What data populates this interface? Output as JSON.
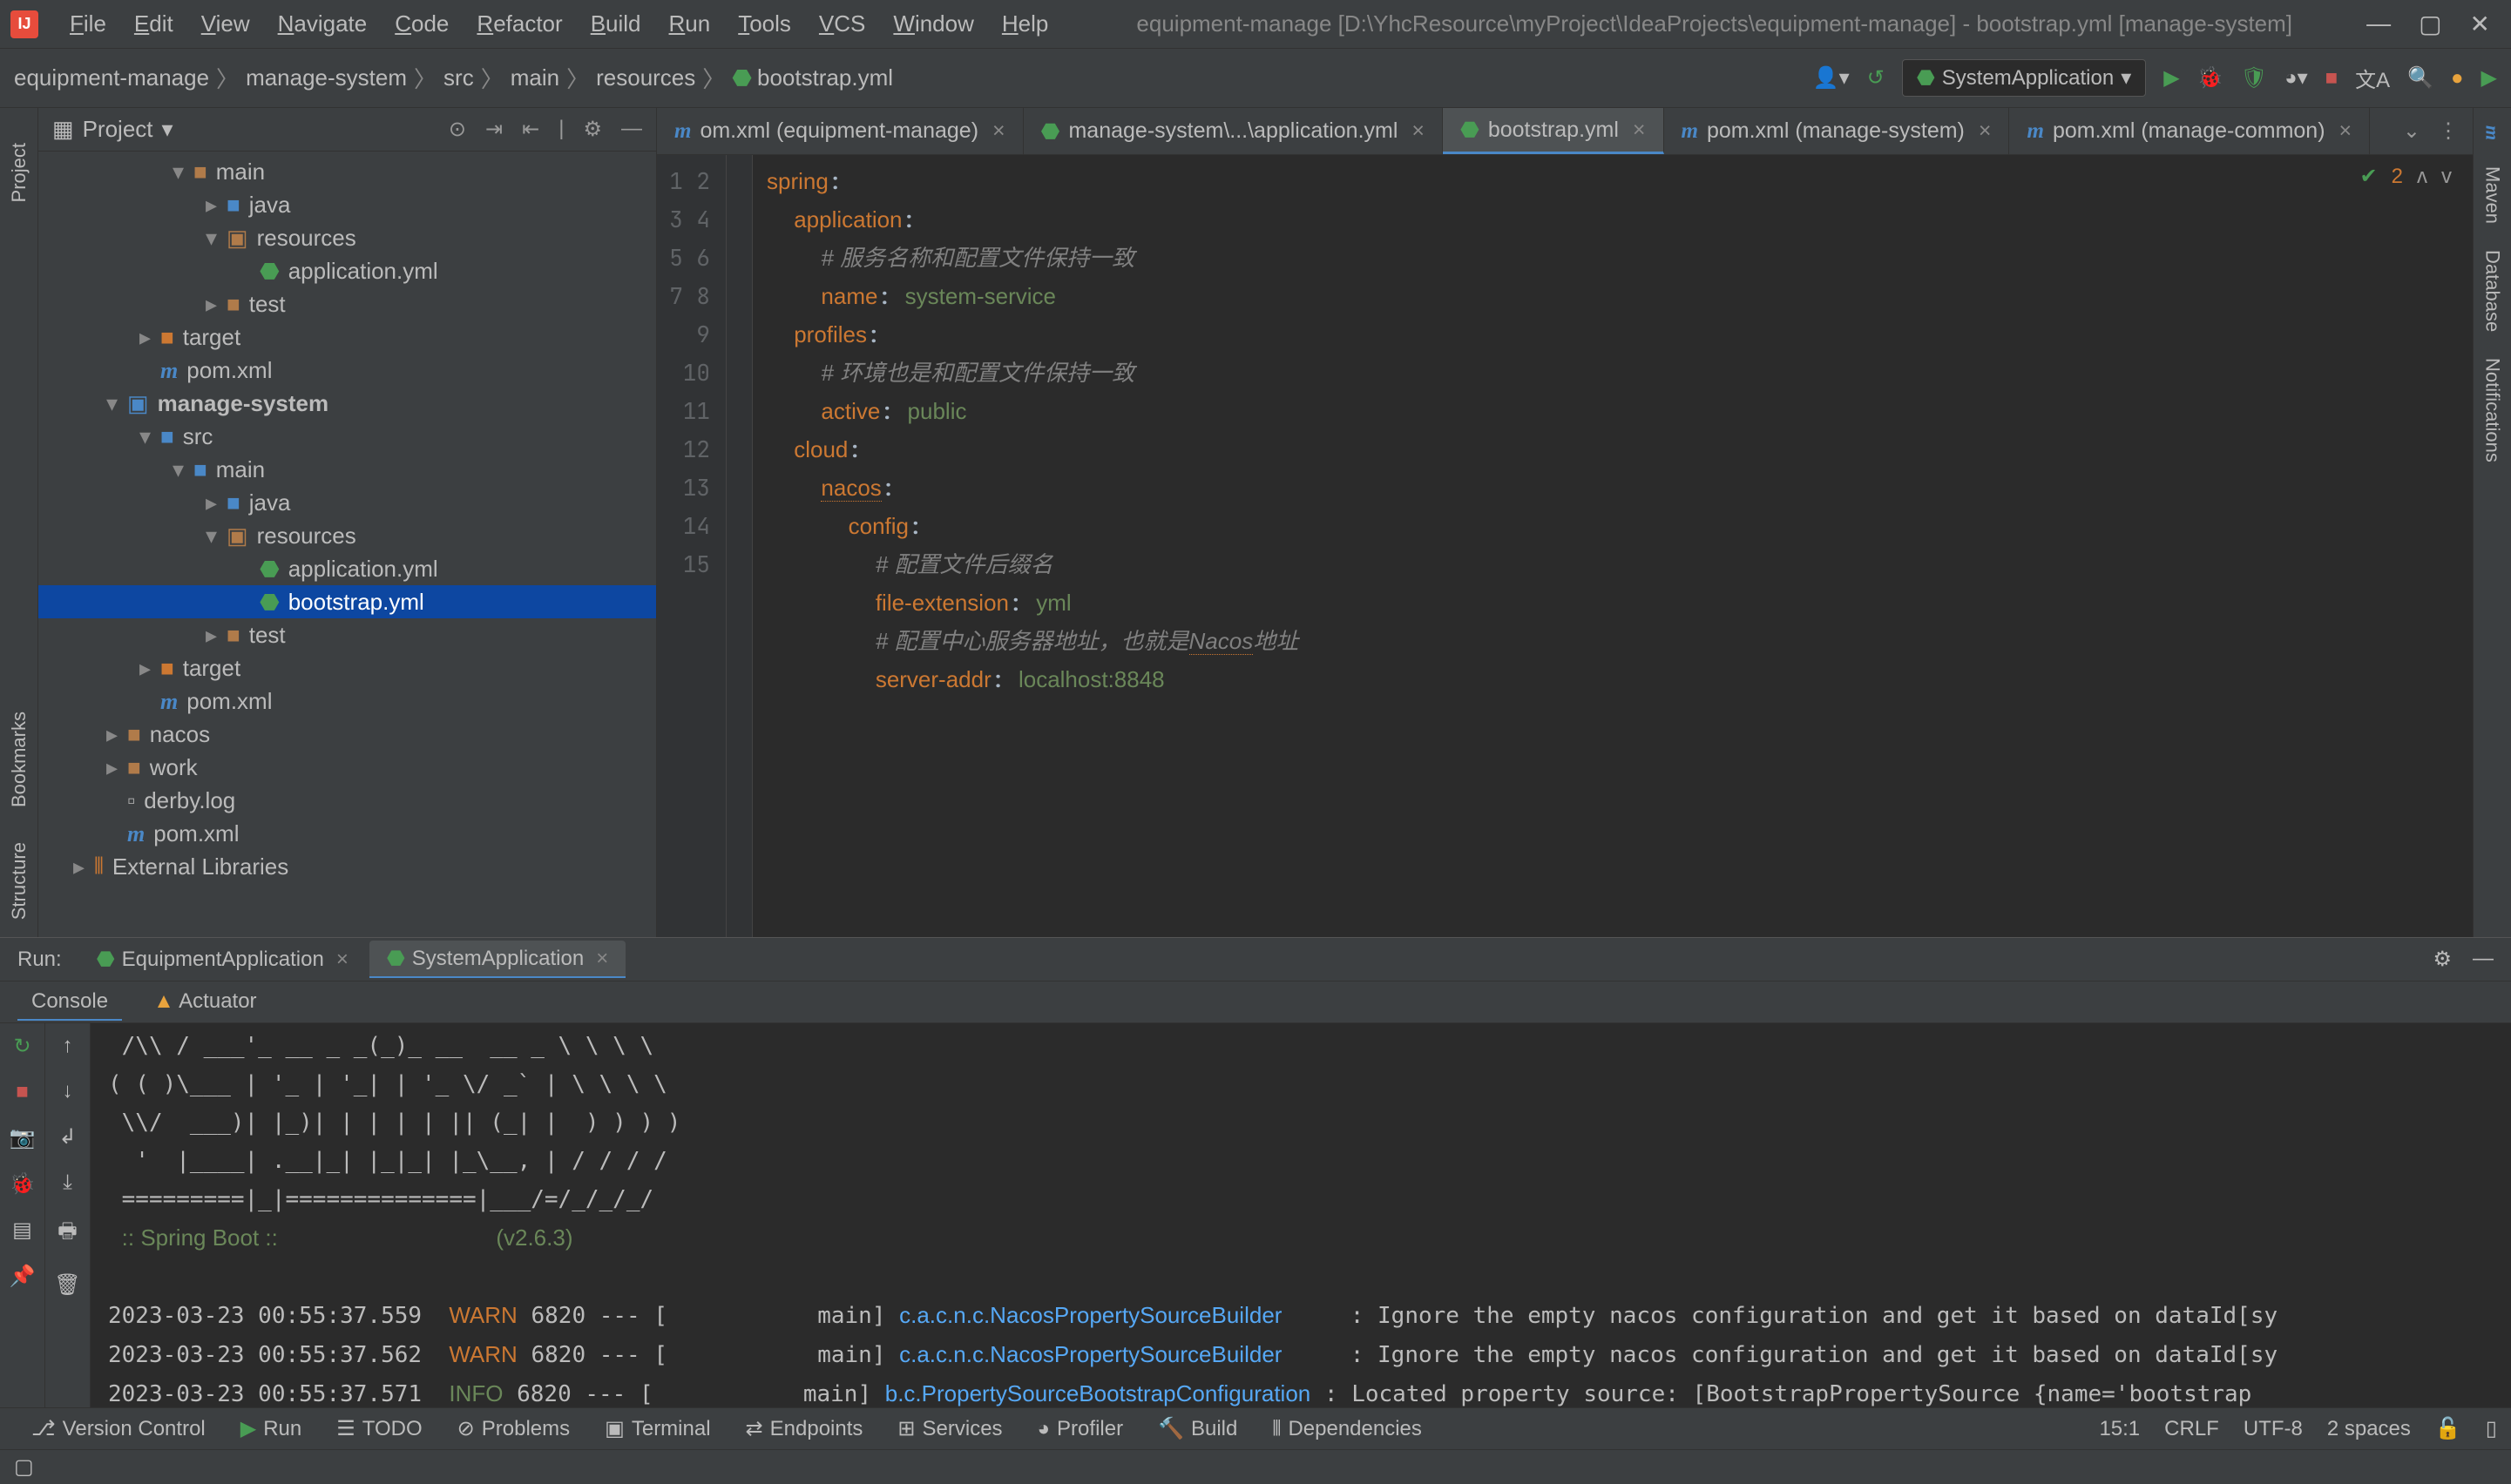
{
  "window": {
    "title": "equipment-manage [D:\\YhcResource\\myProject\\IdeaProjects\\equipment-manage] - bootstrap.yml [manage-system]"
  },
  "menu": [
    "File",
    "Edit",
    "View",
    "Navigate",
    "Code",
    "Refactor",
    "Build",
    "Run",
    "Tools",
    "VCS",
    "Window",
    "Help"
  ],
  "breadcrumb": [
    "equipment-manage",
    "manage-system",
    "src",
    "main",
    "resources",
    "bootstrap.yml"
  ],
  "run_config": "SystemApplication",
  "project_panel": {
    "title": "Project"
  },
  "tree": [
    {
      "depth": 3,
      "arrow": "▾",
      "icon": "folder",
      "label": "main",
      "sel": false
    },
    {
      "depth": 4,
      "arrow": "▸",
      "icon": "folder-blue",
      "label": "java",
      "sel": false
    },
    {
      "depth": 4,
      "arrow": "▾",
      "icon": "folder-res",
      "label": "resources",
      "sel": false
    },
    {
      "depth": 5,
      "arrow": "",
      "icon": "leaf",
      "label": "application.yml",
      "sel": false
    },
    {
      "depth": 4,
      "arrow": "▸",
      "icon": "folder",
      "label": "test",
      "sel": false
    },
    {
      "depth": 2,
      "arrow": "▸",
      "icon": "folder-orange",
      "label": "target",
      "sel": false
    },
    {
      "depth": 2,
      "arrow": "",
      "icon": "m",
      "label": "pom.xml",
      "sel": false
    },
    {
      "depth": 1,
      "arrow": "▾",
      "icon": "module",
      "label": "manage-system",
      "bold": true,
      "sel": false
    },
    {
      "depth": 2,
      "arrow": "▾",
      "icon": "folder-blue",
      "label": "src",
      "sel": false
    },
    {
      "depth": 3,
      "arrow": "▾",
      "icon": "folder-blue",
      "label": "main",
      "sel": false
    },
    {
      "depth": 4,
      "arrow": "▸",
      "icon": "folder-blue",
      "label": "java",
      "sel": false
    },
    {
      "depth": 4,
      "arrow": "▾",
      "icon": "folder-res",
      "label": "resources",
      "sel": false
    },
    {
      "depth": 5,
      "arrow": "",
      "icon": "leaf",
      "label": "application.yml",
      "sel": false
    },
    {
      "depth": 5,
      "arrow": "",
      "icon": "leaf",
      "label": "bootstrap.yml",
      "sel": true
    },
    {
      "depth": 4,
      "arrow": "▸",
      "icon": "folder",
      "label": "test",
      "sel": false
    },
    {
      "depth": 2,
      "arrow": "▸",
      "icon": "folder-orange",
      "label": "target",
      "sel": false
    },
    {
      "depth": 2,
      "arrow": "",
      "icon": "m",
      "label": "pom.xml",
      "sel": false
    },
    {
      "depth": 1,
      "arrow": "▸",
      "icon": "folder",
      "label": "nacos",
      "sel": false
    },
    {
      "depth": 1,
      "arrow": "▸",
      "icon": "folder",
      "label": "work",
      "sel": false
    },
    {
      "depth": 1,
      "arrow": "",
      "icon": "file",
      "label": "derby.log",
      "sel": false
    },
    {
      "depth": 1,
      "arrow": "",
      "icon": "m",
      "label": "pom.xml",
      "sel": false
    },
    {
      "depth": 0,
      "arrow": "▸",
      "icon": "lib",
      "label": "External Libraries",
      "sel": false
    }
  ],
  "tabs": [
    {
      "label": "om.xml (equipment-manage)",
      "icon": "m",
      "active": false
    },
    {
      "label": "manage-system\\...\\application.yml",
      "icon": "leaf",
      "active": false
    },
    {
      "label": "bootstrap.yml",
      "icon": "leaf",
      "active": true
    },
    {
      "label": "pom.xml (manage-system)",
      "icon": "m",
      "active": false
    },
    {
      "label": "pom.xml (manage-common)",
      "icon": "m",
      "active": false
    }
  ],
  "inspections": "2",
  "code_lines": [
    {
      "n": 1,
      "html": "<span class='k'>spring</span>:"
    },
    {
      "n": 2,
      "html": "  <span class='k'>application</span>:"
    },
    {
      "n": 3,
      "html": "    <span class='c'># 服务名称和配置文件保持一致</span>"
    },
    {
      "n": 4,
      "html": "    <span class='k'>name</span>: <span class='s'>system-service</span>"
    },
    {
      "n": 5,
      "html": "  <span class='k'>profiles</span>:"
    },
    {
      "n": 6,
      "html": "    <span class='c'># 环境也是和配置文件保持一致</span>"
    },
    {
      "n": 7,
      "html": "    <span class='k'>active</span>: <span class='s'>public</span>"
    },
    {
      "n": 8,
      "html": "  <span class='k'>cloud</span>:"
    },
    {
      "n": 9,
      "html": "    <span class='k u'>nacos</span>:"
    },
    {
      "n": 10,
      "html": "      <span class='k'>config</span>:"
    },
    {
      "n": 11,
      "html": "        <span class='c'># 配置文件后缀名</span>"
    },
    {
      "n": 12,
      "html": "        <span class='k'>file-extension</span>: <span class='s'>yml</span>"
    },
    {
      "n": 13,
      "html": "        <span class='c'># 配置中心服务器地址，也就是<span class='u'>Nacos</span>地址</span>"
    },
    {
      "n": 14,
      "html": "        <span class='k'>server-addr</span>: <span class='s'>localhost:8848</span>"
    },
    {
      "n": 15,
      "html": ""
    }
  ],
  "run": {
    "label": "Run:",
    "tabs": [
      {
        "label": "EquipmentApplication",
        "active": false
      },
      {
        "label": "SystemApplication",
        "active": true
      }
    ],
    "subtabs": [
      {
        "label": "Console",
        "active": true
      },
      {
        "label": "Actuator",
        "active": false
      }
    ]
  },
  "console_lines": [
    " /\\\\ / ___'_ __ _ _(_)_ __  __ _ \\ \\ \\ \\",
    "( ( )\\___ | '_ | '_| | '_ \\/ _` | \\ \\ \\ \\",
    " \\\\/  ___)| |_)| | | | | || (_| |  ) ) ) )",
    "  '  |____| .__|_| |_|_| |_\\__, | / / / /",
    " =========|_|==============|___/=/_/_/_/",
    " <span class='info'>:: Spring Boot ::</span>                <span class='s'>(v2.6.3)</span>",
    "",
    "2023-03-23 00:55:37.559  <span class='warn'>WARN</span> 6820 --- [           main] <span class='cls'>c.a.c.n.c.NacosPropertySourceBuilder</span>     : Ignore the empty nacos configuration and get it based on dataId[sy",
    "2023-03-23 00:55:37.562  <span class='warn'>WARN</span> 6820 --- [           main] <span class='cls'>c.a.c.n.c.NacosPropertySourceBuilder</span>     : Ignore the empty nacos configuration and get it based on dataId[sy",
    "2023-03-23 00:55:37.571  <span class='info'>INFO</span> 6820 --- [           main] <span class='cls'>b.c.PropertySourceBootstrapConfiguration</span> : Located property source: [BootstrapPropertySource {name='bootstrap"
  ],
  "status_items": [
    "Version Control",
    "Run",
    "TODO",
    "Problems",
    "Terminal",
    "Endpoints",
    "Services",
    "Profiler",
    "Build",
    "Dependencies"
  ],
  "status_right": {
    "pos": "15:1",
    "sep": "CRLF",
    "enc": "UTF-8",
    "indent": "2 spaces"
  },
  "left_tools": [
    "Project",
    "Bookmarks",
    "Structure"
  ],
  "right_tools": [
    "Maven",
    "Database",
    "Notifications"
  ]
}
